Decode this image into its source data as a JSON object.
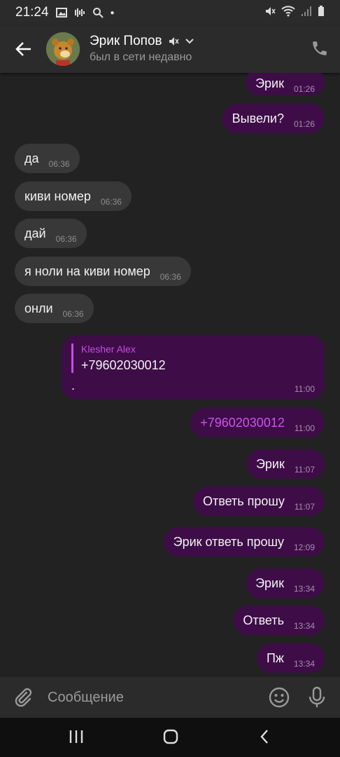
{
  "status_bar": {
    "time": "21:24"
  },
  "header": {
    "name": "Эрик Попов",
    "status": "был в сети недавно"
  },
  "messages": [
    {
      "dir": "out",
      "text": "Эрик",
      "time": "01:26"
    },
    {
      "dir": "out",
      "text": "Вывели?",
      "time": "01:26"
    },
    {
      "dir": "in",
      "text": "да",
      "time": "06:36"
    },
    {
      "dir": "in",
      "text": "киви номер",
      "time": "06:36"
    },
    {
      "dir": "in",
      "text": "дай",
      "time": "06:36"
    },
    {
      "dir": "in",
      "text": "я ноли на киви номер",
      "time": "06:36"
    },
    {
      "dir": "in",
      "text": "онли",
      "time": "06:36"
    },
    {
      "dir": "out",
      "reply_name": "Klesher Alex",
      "reply_text": "+79602030012",
      "text": ".",
      "time": "11:00"
    },
    {
      "dir": "out",
      "text": "+79602030012",
      "time": "11:00"
    },
    {
      "dir": "out",
      "text": "Эрик",
      "time": "11:07"
    },
    {
      "dir": "out",
      "text": "Ответь прошу",
      "time": "11:07"
    },
    {
      "dir": "out",
      "text": "Эрик ответь прошу",
      "time": "12:09"
    },
    {
      "dir": "out",
      "text": "Эрик",
      "time": "13:34"
    },
    {
      "dir": "out",
      "text": "Ответь",
      "time": "13:34"
    },
    {
      "dir": "out",
      "text": "Пж",
      "time": "13:34"
    }
  ],
  "composer": {
    "placeholder": "Сообщение"
  },
  "colors": {
    "outgoing_bubble": "#3e0d48",
    "incoming_bubble": "#383838",
    "accent": "#c24fe0",
    "background": "#222222"
  }
}
